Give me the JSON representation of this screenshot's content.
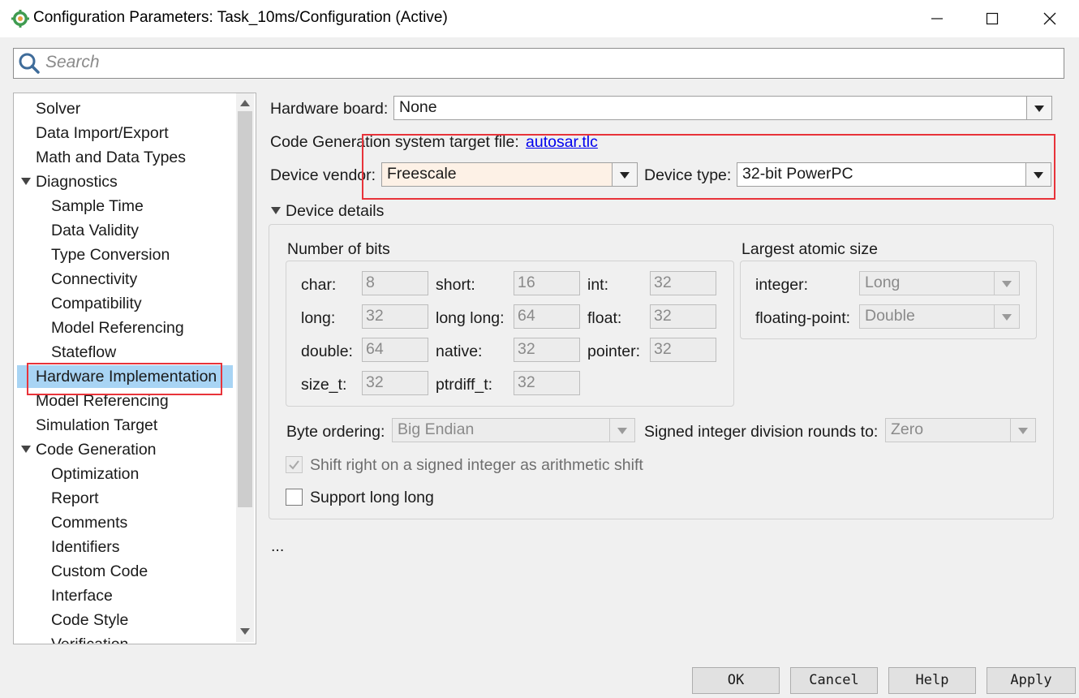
{
  "window": {
    "title": "Configuration Parameters: Task_10ms/Configuration (Active)",
    "icons": [
      "gear-app-icon",
      "minimize-icon",
      "maximize-icon",
      "close-icon"
    ]
  },
  "search": {
    "placeholder": "Search",
    "value": ""
  },
  "tree": {
    "items": [
      {
        "label": "Solver"
      },
      {
        "label": "Data Import/Export"
      },
      {
        "label": "Math and Data Types"
      },
      {
        "label": "Diagnostics"
      },
      {
        "label": "Sample Time"
      },
      {
        "label": "Data Validity"
      },
      {
        "label": "Type Conversion"
      },
      {
        "label": "Connectivity"
      },
      {
        "label": "Compatibility"
      },
      {
        "label": "Model Referencing"
      },
      {
        "label": "Stateflow"
      },
      {
        "label": "Hardware Implementation"
      },
      {
        "label": "Model Referencing"
      },
      {
        "label": "Simulation Target"
      },
      {
        "label": "Code Generation"
      },
      {
        "label": "Optimization"
      },
      {
        "label": "Report"
      },
      {
        "label": "Comments"
      },
      {
        "label": "Identifiers"
      },
      {
        "label": "Custom Code"
      },
      {
        "label": "Interface"
      },
      {
        "label": "Code Style"
      },
      {
        "label": "Verification"
      }
    ],
    "selected": "Hardware Implementation"
  },
  "hardware": {
    "board_label": "Hardware board:",
    "board_value": "None",
    "target_label": "Code Generation system target file:",
    "target_link": "autosar.tlc",
    "vendor_label": "Device vendor:",
    "vendor_value": "Freescale",
    "type_label": "Device type:",
    "type_value": "32-bit PowerPC"
  },
  "details": {
    "section_label": "Device details",
    "bits_title": "Number of bits",
    "bits": {
      "char_label": "char:",
      "char": "8",
      "short_label": "short:",
      "short": "16",
      "int_label": "int:",
      "int": "32",
      "long_label": "long:",
      "long": "32",
      "longlong_label": "long long:",
      "longlong": "64",
      "float_label": "float:",
      "float": "32",
      "double_label": "double:",
      "double": "64",
      "native_label": "native:",
      "native": "32",
      "pointer_label": "pointer:",
      "pointer": "32",
      "sizet_label": "size_t:",
      "sizet": "32",
      "ptrdiff_label": "ptrdiff_t:",
      "ptrdiff": "32"
    },
    "atomic_title": "Largest atomic size",
    "integer_label": "integer:",
    "integer_value": "Long",
    "float_label": "floating-point:",
    "float_value": "Double",
    "byte_order_label": "Byte ordering:",
    "byte_order_value": "Big Endian",
    "division_label": "Signed integer division rounds to:",
    "division_value": "Zero",
    "shift_label": "Shift right on a signed integer as arithmetic shift",
    "shift_checked": true,
    "longlong_support_label": "Support long long",
    "longlong_support_checked": false
  },
  "ellipsis": "...",
  "buttons": {
    "ok": "OK",
    "cancel": "Cancel",
    "help": "Help",
    "apply": "Apply"
  },
  "colors": {
    "selection": "#a8d4f4",
    "highlight_box": "#e8333a",
    "vendor_bg": "#fdf1e6",
    "link": "#0000ee"
  }
}
